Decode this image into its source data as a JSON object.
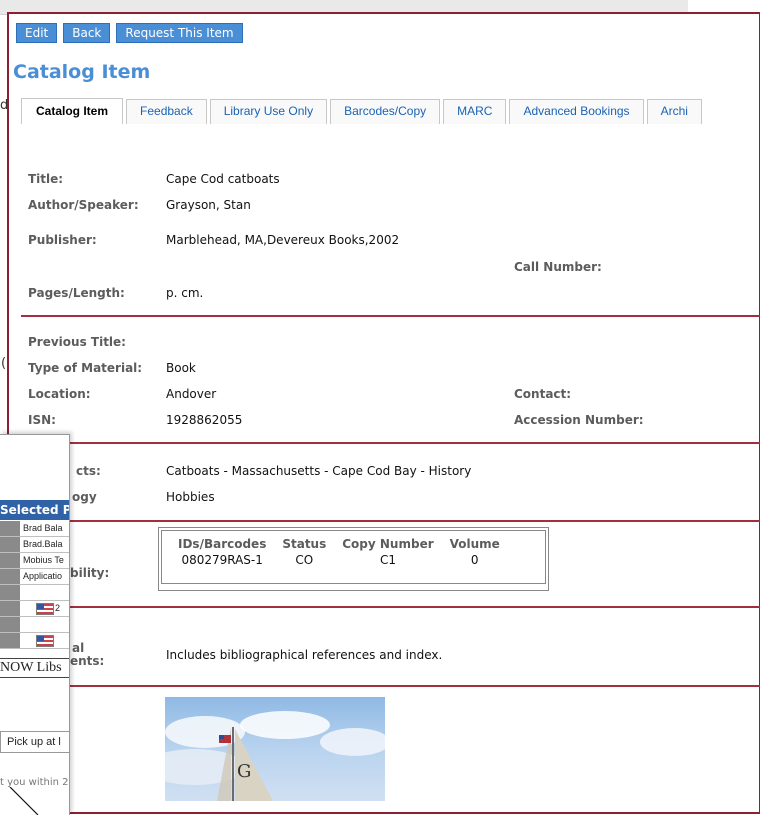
{
  "toolbar": {
    "edit": "Edit",
    "back": "Back",
    "request": "Request This Item"
  },
  "page_title": "Catalog Item",
  "tabs": [
    "Catalog Item",
    "Feedback",
    "Library Use Only",
    "Barcodes/Copy",
    "MARC",
    "Advanced Bookings",
    "Archi"
  ],
  "fields": {
    "title_label": "Title:",
    "title": "Cape Cod catboats",
    "author_label": "Author/Speaker:",
    "author": "Grayson, Stan",
    "publisher_label": "Publisher:",
    "publisher": "Marblehead, MA,Devereux Books,2002",
    "call_number_label": "Call Number:",
    "pages_label": "Pages/Length:",
    "pages": "p. cm.",
    "previous_title_label": "Previous Title:",
    "type_label": "Type of Material:",
    "type": "Book",
    "location_label": "Location:",
    "location": "Andover",
    "contact_label": "Contact:",
    "isn_label": "ISN:",
    "isn": "1928862055",
    "accession_label": "Accession Number:",
    "subjects_label_partial": "cts:",
    "subjects": "Catboats - Massachusetts - Cape Cod Bay - History",
    "ogy_label_partial": "ogy",
    "ogy": "Hobbies",
    "availability_label_partial": "bility:",
    "notes_label_partial_1": "al",
    "notes_label_partial_2": "ents:",
    "notes": "Includes bibliographical references and index."
  },
  "availability": {
    "headers": [
      "IDs/Barcodes",
      "Status",
      "Copy Number",
      "Volume"
    ],
    "rows": [
      [
        "080279RAS-1",
        "CO",
        "C1",
        "0"
      ]
    ]
  },
  "background": {
    "chars": [
      "d",
      "("
    ]
  },
  "overlay": {
    "header": "Selected Pe",
    "rows": [
      "Brad Bala",
      "Brad.Bala",
      "Mobius Te",
      "Applicatio"
    ],
    "flag_suffix": "2",
    "libs": "NOW Libs",
    "pickup": "Pick up at l",
    "small_text": "t you within 2"
  },
  "colors": {
    "accent": "#4a8fd6",
    "border": "#8b2032",
    "separator": "#a0303f",
    "label": "#5c5c5c",
    "link": "#1a63b4"
  }
}
